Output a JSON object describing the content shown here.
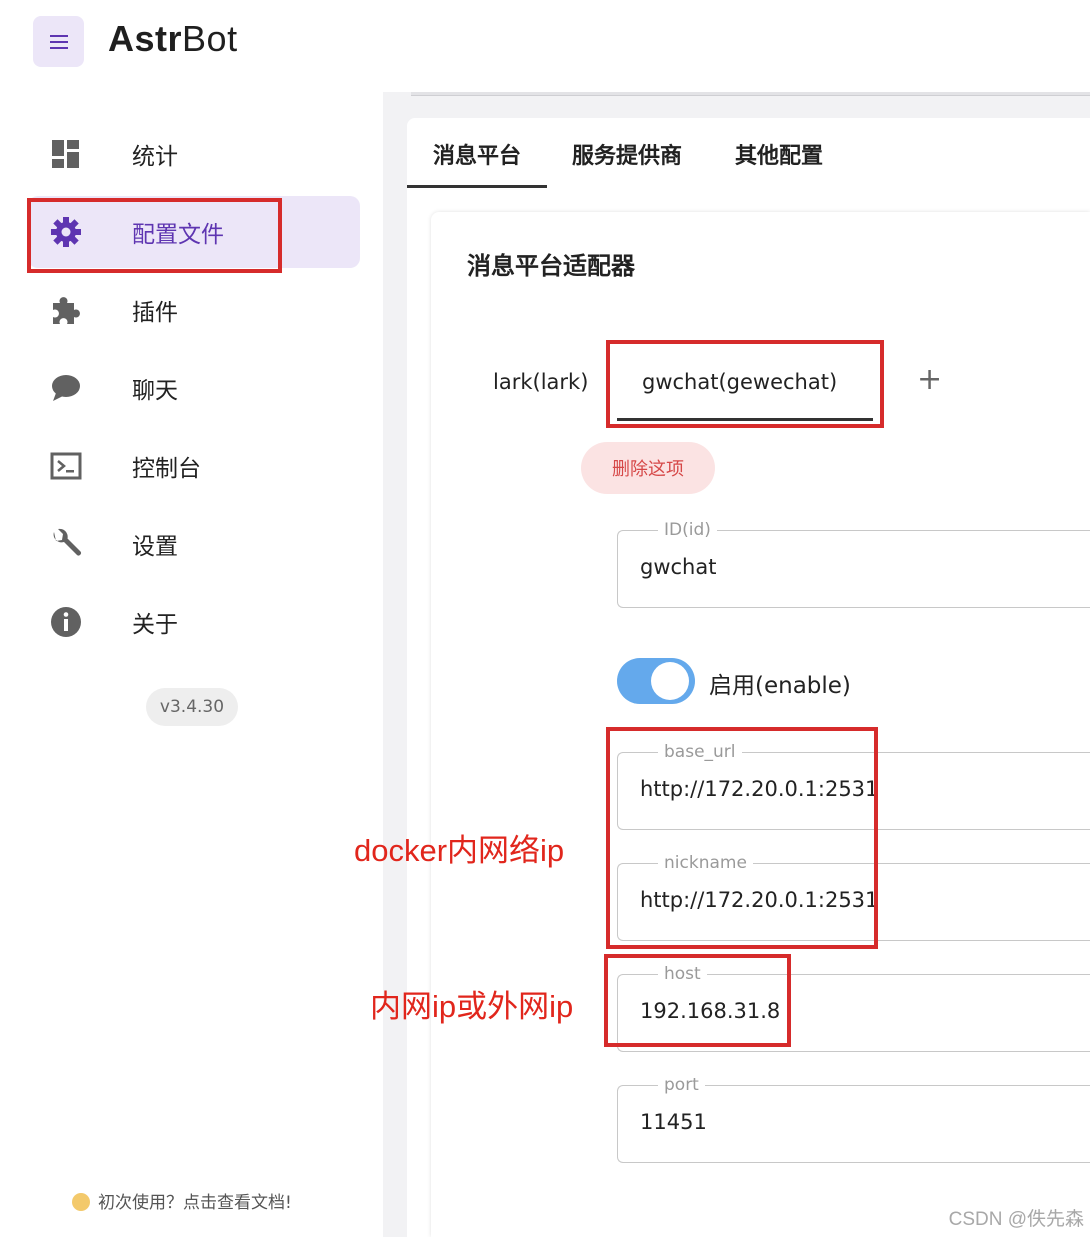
{
  "app": {
    "brand_bold": "Astr",
    "brand_rest": "Bot",
    "menu_icon": "hamburger-menu-icon"
  },
  "sidebar": {
    "items": [
      {
        "label": "统计",
        "icon": "dashboard-icon",
        "active": false
      },
      {
        "label": "配置文件",
        "icon": "gear-icon",
        "active": true
      },
      {
        "label": "插件",
        "icon": "puzzle-icon",
        "active": false
      },
      {
        "label": "聊天",
        "icon": "chat-bubble-icon",
        "active": false
      },
      {
        "label": "控制台",
        "icon": "terminal-icon",
        "active": false
      },
      {
        "label": "设置",
        "icon": "wrench-icon",
        "active": false
      },
      {
        "label": "关于",
        "icon": "info-icon",
        "active": false
      }
    ],
    "version": "v3.4.30",
    "doc_link": "初次使用？点击查看文档!"
  },
  "tabs": [
    "消息平台",
    "服务提供商",
    "其他配置"
  ],
  "section": {
    "title": "消息平台适配器",
    "subtabs": [
      "lark(lark)",
      "gwchat(gewechat)"
    ],
    "add_label": "+",
    "delete_label": "删除这项",
    "fields": {
      "id": {
        "label": "ID(id)",
        "value": "gwchat"
      },
      "enable": {
        "label": "启用(enable)",
        "value": true
      },
      "base_url": {
        "label": "base_url",
        "value": "http://172.20.0.1:2531"
      },
      "nickname": {
        "label": "nickname",
        "value": "http://172.20.0.1:2531"
      },
      "host": {
        "label": "host",
        "value": "192.168.31.8"
      },
      "port": {
        "label": "port",
        "value": "11451"
      }
    }
  },
  "annotations": {
    "docker_note": "docker内网络ip",
    "host_note": "内网ip或外网ip"
  },
  "watermark": "CSDN @佚先森",
  "colors": {
    "accent": "#5e35b1",
    "active_bg": "#ece6f8",
    "toggle": "#64a9ec",
    "annotation": "#d62b2b",
    "danger": "#d64848"
  }
}
